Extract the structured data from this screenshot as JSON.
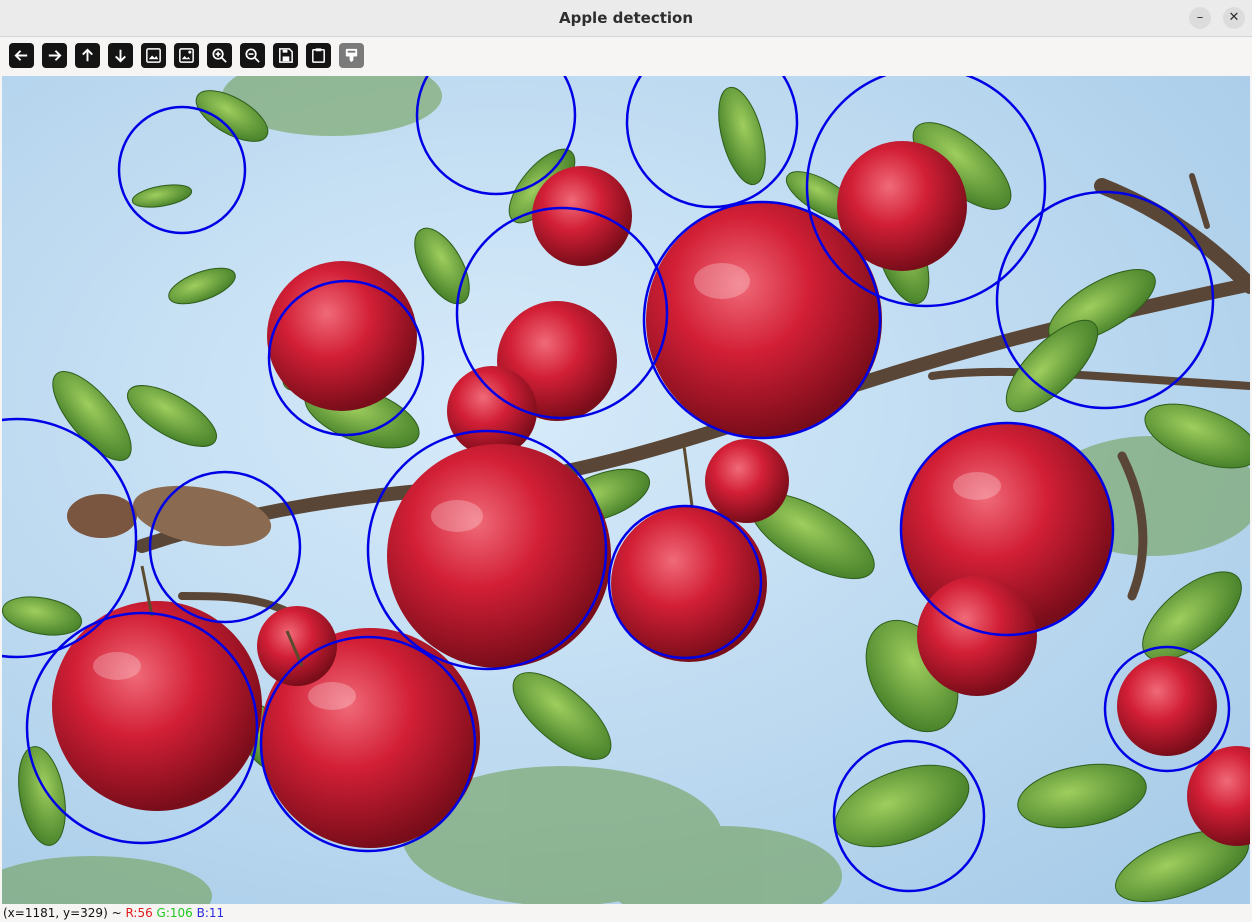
{
  "window": {
    "title": "Apple detection",
    "minimize_glyph": "–",
    "close_glyph": "✕"
  },
  "toolbar": {
    "buttons": [
      {
        "icon": "arrow-left-icon"
      },
      {
        "icon": "arrow-right-icon"
      },
      {
        "icon": "arrow-up-icon"
      },
      {
        "icon": "arrow-down-icon"
      },
      {
        "icon": "image-icon"
      },
      {
        "icon": "image-settings-icon"
      },
      {
        "icon": "zoom-in-icon"
      },
      {
        "icon": "zoom-out-icon"
      },
      {
        "icon": "save-icon"
      },
      {
        "icon": "clipboard-icon"
      },
      {
        "icon": "properties-icon"
      }
    ]
  },
  "detections": {
    "circle_color": "#0000e6",
    "count": 20
  },
  "status": {
    "coords": "(x=1181, y=329) ~ ",
    "r": "R:56",
    "g": "G:106",
    "b": "B:11"
  }
}
